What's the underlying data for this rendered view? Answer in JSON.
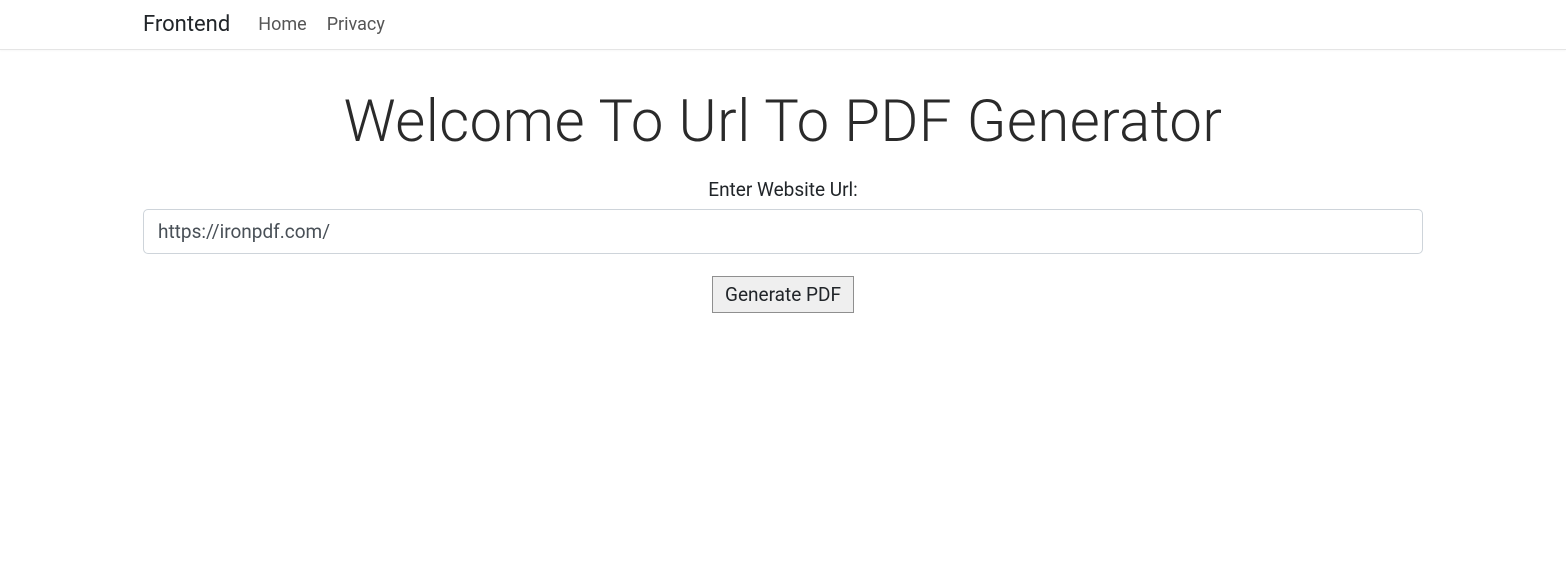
{
  "navbar": {
    "brand": "Frontend",
    "links": [
      {
        "label": "Home"
      },
      {
        "label": "Privacy"
      }
    ]
  },
  "main": {
    "title": "Welcome To Url To PDF Generator",
    "url_label": "Enter Website Url:",
    "url_value": "https://ironpdf.com/",
    "generate_button": "Generate PDF"
  }
}
